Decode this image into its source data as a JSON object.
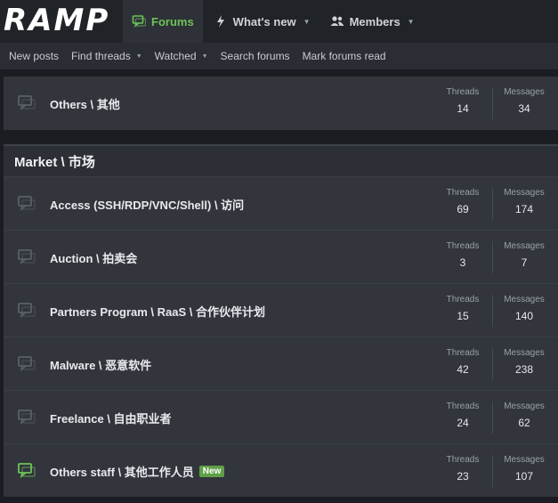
{
  "header": {
    "logo": "RAMP",
    "tabs": [
      {
        "label": "Forums",
        "icon": "forum-icon",
        "active": true
      },
      {
        "label": "What's new",
        "icon": "bolt-icon",
        "active": false
      },
      {
        "label": "Members",
        "icon": "members-icon",
        "active": false
      }
    ],
    "accent": "#6fc25a"
  },
  "subnav": {
    "items": [
      "New posts",
      "Find threads",
      "Watched",
      "Search forums",
      "Mark forums read"
    ]
  },
  "stats_labels": {
    "threads": "Threads",
    "messages": "Messages"
  },
  "top_forum": {
    "title": "Others \\ 其他",
    "threads": "14",
    "messages": "34",
    "unread": false
  },
  "market": {
    "heading": "Market \\ 市场",
    "forums": [
      {
        "title": "Access (SSH/RDP/VNC/Shell) \\ 访问",
        "threads": "69",
        "messages": "174",
        "unread": false,
        "badge": ""
      },
      {
        "title": "Auction \\ 拍卖会",
        "threads": "3",
        "messages": "7",
        "unread": false,
        "badge": ""
      },
      {
        "title": "Partners Program \\ RaaS \\ 合作伙伴计划",
        "threads": "15",
        "messages": "140",
        "unread": false,
        "badge": ""
      },
      {
        "title": "Malware \\ 恶意软件",
        "threads": "42",
        "messages": "238",
        "unread": false,
        "badge": ""
      },
      {
        "title": "Freelance \\ 自由职业者",
        "threads": "24",
        "messages": "62",
        "unread": false,
        "badge": ""
      },
      {
        "title": "Others staff \\ 其他工作人员",
        "threads": "23",
        "messages": "107",
        "unread": true,
        "badge": "New"
      }
    ]
  },
  "colors": {
    "unread_icon": "#6fc25a",
    "read_icon": "#5a5f66"
  }
}
